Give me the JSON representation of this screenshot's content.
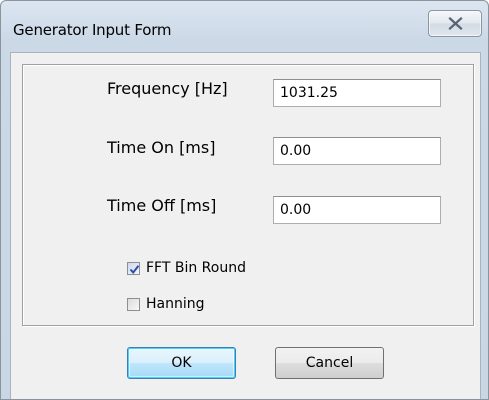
{
  "window": {
    "title": "Generator Input Form"
  },
  "fields": {
    "frequency": {
      "label": "Frequency [Hz]",
      "value": "1031.25"
    },
    "time_on": {
      "label": "Time On [ms]",
      "value": "0.00"
    },
    "time_off": {
      "label": "Time Off [ms]",
      "value": "0.00"
    }
  },
  "options": {
    "fft_bin_round": {
      "label": "FFT Bin Round",
      "checked": true
    },
    "hanning": {
      "label": "Hanning",
      "checked": false
    }
  },
  "buttons": {
    "ok": "OK",
    "cancel": "Cancel"
  },
  "icons": {
    "close": "close-icon",
    "check": "checkmark-icon"
  },
  "colors": {
    "title_bar": "#cbd8e6",
    "client_bg": "#f0f0f0",
    "default_button_border": "#3c7fb1",
    "check_mark": "#2b4fa8"
  }
}
